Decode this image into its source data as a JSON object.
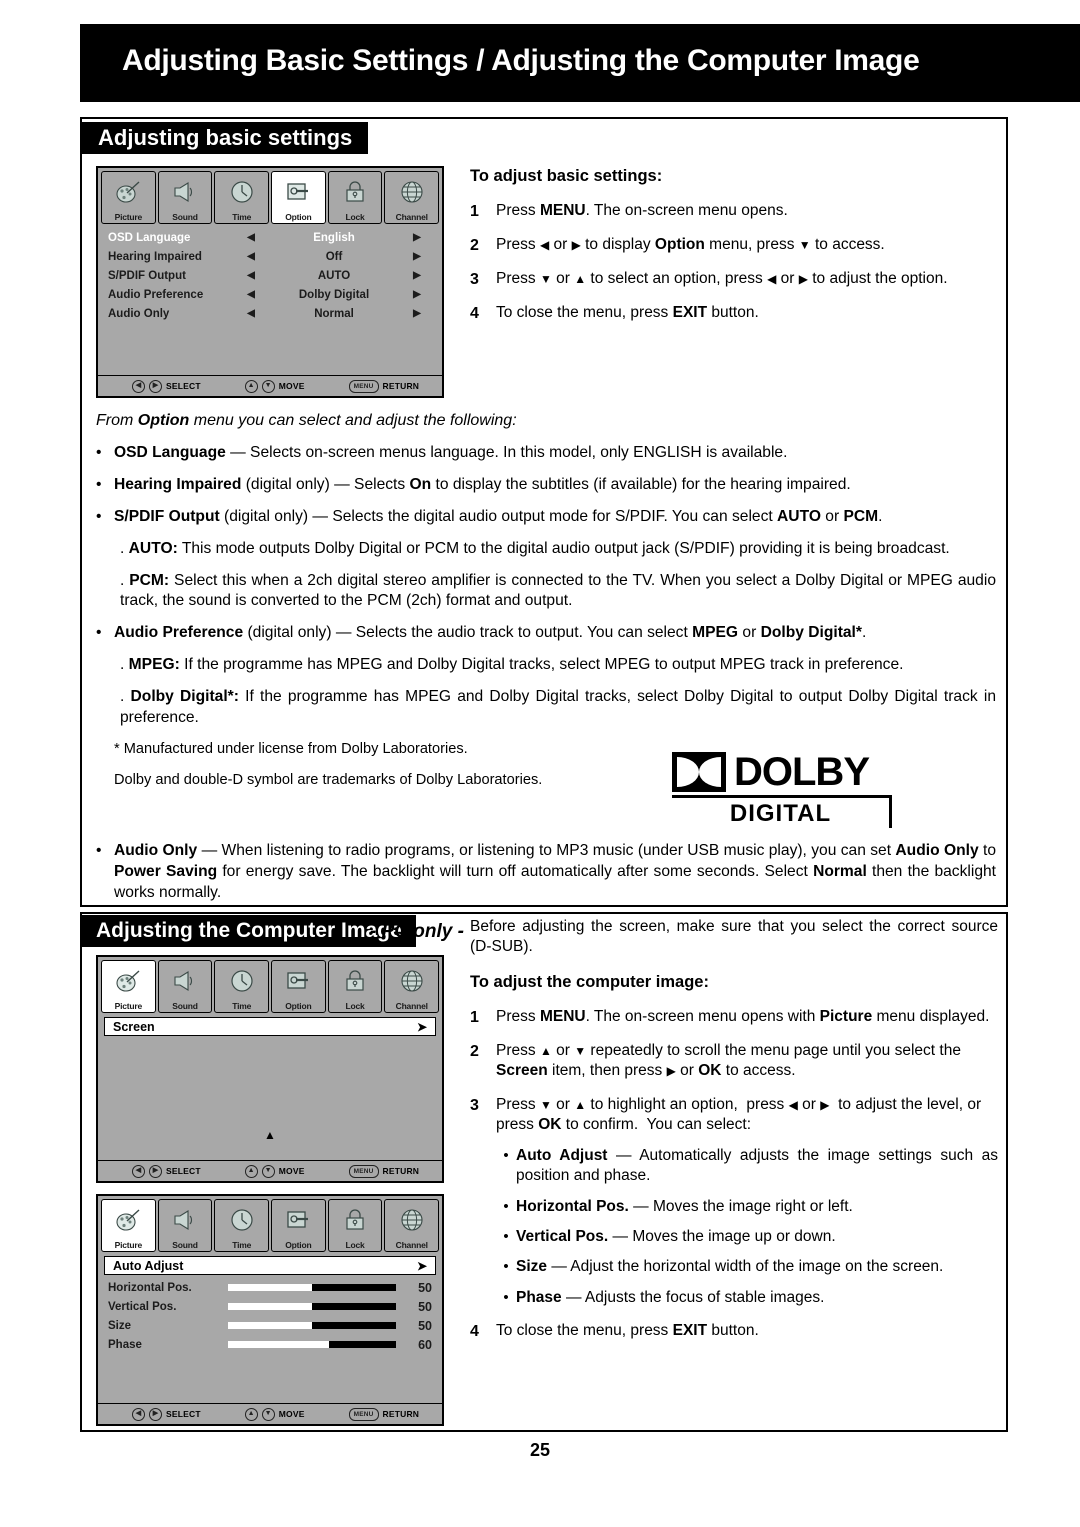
{
  "header": {
    "title": "Adjusting Basic Settings / Adjusting the Computer Image"
  },
  "page": {
    "number": "25"
  },
  "colors": {
    "banner_bg": "#000000",
    "osd_bg": "#a8a8a8",
    "highlight": "#ffffff"
  },
  "section_basic": {
    "band_title": "Adjusting basic settings",
    "osd": {
      "tabs": [
        {
          "label": "Picture",
          "icon": "palette-icon",
          "active": false
        },
        {
          "label": "Sound",
          "icon": "speaker-icon",
          "active": false
        },
        {
          "label": "Time",
          "icon": "clock-icon",
          "active": false
        },
        {
          "label": "Option",
          "icon": "wrench-screen-icon",
          "active": true
        },
        {
          "label": "Lock",
          "icon": "padlock-icon",
          "active": false
        },
        {
          "label": "Channel",
          "icon": "globe-icon",
          "active": false
        }
      ],
      "rows": [
        {
          "label": "OSD Language",
          "value": "English",
          "selected": true
        },
        {
          "label": "Hearing Impaired",
          "value": "Off",
          "selected": false
        },
        {
          "label": "S/PDIF Output",
          "value": "AUTO",
          "selected": false
        },
        {
          "label": "Audio Preference",
          "value": "Dolby Digital",
          "selected": false
        },
        {
          "label": "Audio Only",
          "value": "Normal",
          "selected": false
        }
      ],
      "footer": {
        "select": "SELECT",
        "move": "MOVE",
        "return": "RETURN",
        "menu_btn": "MENU"
      }
    },
    "instructions": {
      "heading": "To adjust basic settings:",
      "steps": [
        {
          "num": "1",
          "text": "Press MENU. The on-screen menu opens."
        },
        {
          "num": "2",
          "text": "Press ◀ or ▶ to display Option menu, press ▼ to access."
        },
        {
          "num": "3",
          "text": "Press ▼ or ▲ to select an option, press ◀ or ▶ to adjust the option."
        },
        {
          "num": "4",
          "text": "To close the menu, press EXIT button."
        }
      ]
    },
    "intro": "From Option menu you can select and adjust the following:",
    "bullets": [
      {
        "term": "OSD Language",
        "text": "— Selects on-screen menus language. In this model, only ENGLISH is available."
      },
      {
        "term": "Hearing Impaired",
        "text": "(digital only) —  Selects On to display the subtitles (if available) for the hearing impaired."
      },
      {
        "term": "S/PDIF Output",
        "text": "(digital only) — Selects the digital audio output mode for S/PDIF. You can select AUTO or PCM."
      }
    ],
    "sub_auto": ". AUTO: This mode outputs Dolby Digital or PCM to the digital audio output jack (S/PDIF) providing it is being broadcast.",
    "sub_pcm": ". PCM: Select this when a 2ch digital stereo amplifier is connected to the TV. When you select a Dolby Digital or MPEG audio track, the sound is converted to the PCM (2ch) format and output.",
    "bullet_audio_pref": {
      "term": "Audio Preference",
      "text": "(digital only) —  Selects the audio track to output. You can select MPEG or Dolby Digital*."
    },
    "sub_mpeg": ". MPEG: If the programme has MPEG and Dolby Digital tracks, select MPEG to output MPEG track in preference.",
    "sub_dolby": ". Dolby Digital*: If the programme has MPEG and Dolby Digital tracks, select Dolby Digital to output Dolby Digital track in preference.",
    "note1": "* Manufactured under license from Dolby Laboratories.",
    "note2": "Dolby and double-D symbol are trademarks of Dolby Laboratories.",
    "dolby_logo": {
      "word": "DOLBY",
      "sub": "DIGITAL"
    },
    "bullet_audio_only": {
      "term": "Audio Only",
      "text": "— When listening to radio programs, or listening to MP3 music (under USB music play), you can set Audio Only to Power Saving for energy save. The backlight will turn off automatically after some seconds. Select Normal then the backlight works normally."
    }
  },
  "section_pc": {
    "band_title": "Adjusting the Computer Image",
    "band_suffix": "- PC only -",
    "osd_screen": {
      "tabs": [
        {
          "label": "Picture",
          "icon": "palette-icon",
          "active": true
        },
        {
          "label": "Sound",
          "icon": "speaker-icon",
          "active": false
        },
        {
          "label": "Time",
          "icon": "clock-icon",
          "active": false
        },
        {
          "label": "Option",
          "icon": "wrench-screen-icon",
          "active": false
        },
        {
          "label": "Lock",
          "icon": "padlock-icon",
          "active": false
        },
        {
          "label": "Channel",
          "icon": "globe-icon",
          "active": false
        }
      ],
      "item": "Screen",
      "item_arrow": "➤",
      "scroll_up_indicator": "▲",
      "footer": {
        "select": "SELECT",
        "move": "MOVE",
        "return": "RETURN",
        "menu_btn": "MENU"
      }
    },
    "osd_adjust": {
      "tabs": [
        {
          "label": "Picture",
          "icon": "palette-icon",
          "active": true
        },
        {
          "label": "Sound",
          "icon": "speaker-icon",
          "active": false
        },
        {
          "label": "Time",
          "icon": "clock-icon",
          "active": false
        },
        {
          "label": "Option",
          "icon": "wrench-screen-icon",
          "active": false
        },
        {
          "label": "Lock",
          "icon": "padlock-icon",
          "active": false
        },
        {
          "label": "Channel",
          "icon": "globe-icon",
          "active": false
        }
      ],
      "item": "Auto Adjust",
      "item_arrow": "➤",
      "sliders": [
        {
          "label": "Horizontal Pos.",
          "value": "50",
          "fill_pct": 50
        },
        {
          "label": "Vertical Pos.",
          "value": "50",
          "fill_pct": 50
        },
        {
          "label": "Size",
          "value": "50",
          "fill_pct": 50
        },
        {
          "label": "Phase",
          "value": "60",
          "fill_pct": 60
        }
      ],
      "footer": {
        "select": "SELECT",
        "move": "MOVE",
        "return": "RETURN",
        "menu_btn": "MENU"
      }
    },
    "intro": "Before adjusting the screen, make sure that you select the correct source (D-SUB).",
    "instructions": {
      "heading": "To adjust the computer image:",
      "step1": {
        "num": "1",
        "text": "Press MENU. The on-screen menu opens with Picture menu displayed."
      },
      "step2": {
        "num": "2",
        "text": "Press ▲ or ▼ repeatedly to scroll the menu page until you select the Screen item, then press ▶ or OK to access."
      },
      "step3": {
        "num": "3",
        "text": "Press ▼ or ▲ to highlight an option,  press ◀ or ▶  to adjust the level, or press OK to confirm.  You can select:"
      },
      "options": [
        {
          "term": "Auto Adjust",
          "text": "— Automatically adjusts the image settings such as position and phase."
        },
        {
          "term": "Horizontal Pos.",
          "text": "— Moves the image right or left."
        },
        {
          "term": "Vertical Pos.",
          "text": "— Moves the image up or down."
        },
        {
          "term": "Size",
          "text": "— Adjust the horizontal width of the image on the screen."
        },
        {
          "term": "Phase",
          "text": "— Adjusts the focus of stable images."
        }
      ],
      "step4": {
        "num": "4",
        "text": "To close the menu, press EXIT button."
      }
    }
  }
}
